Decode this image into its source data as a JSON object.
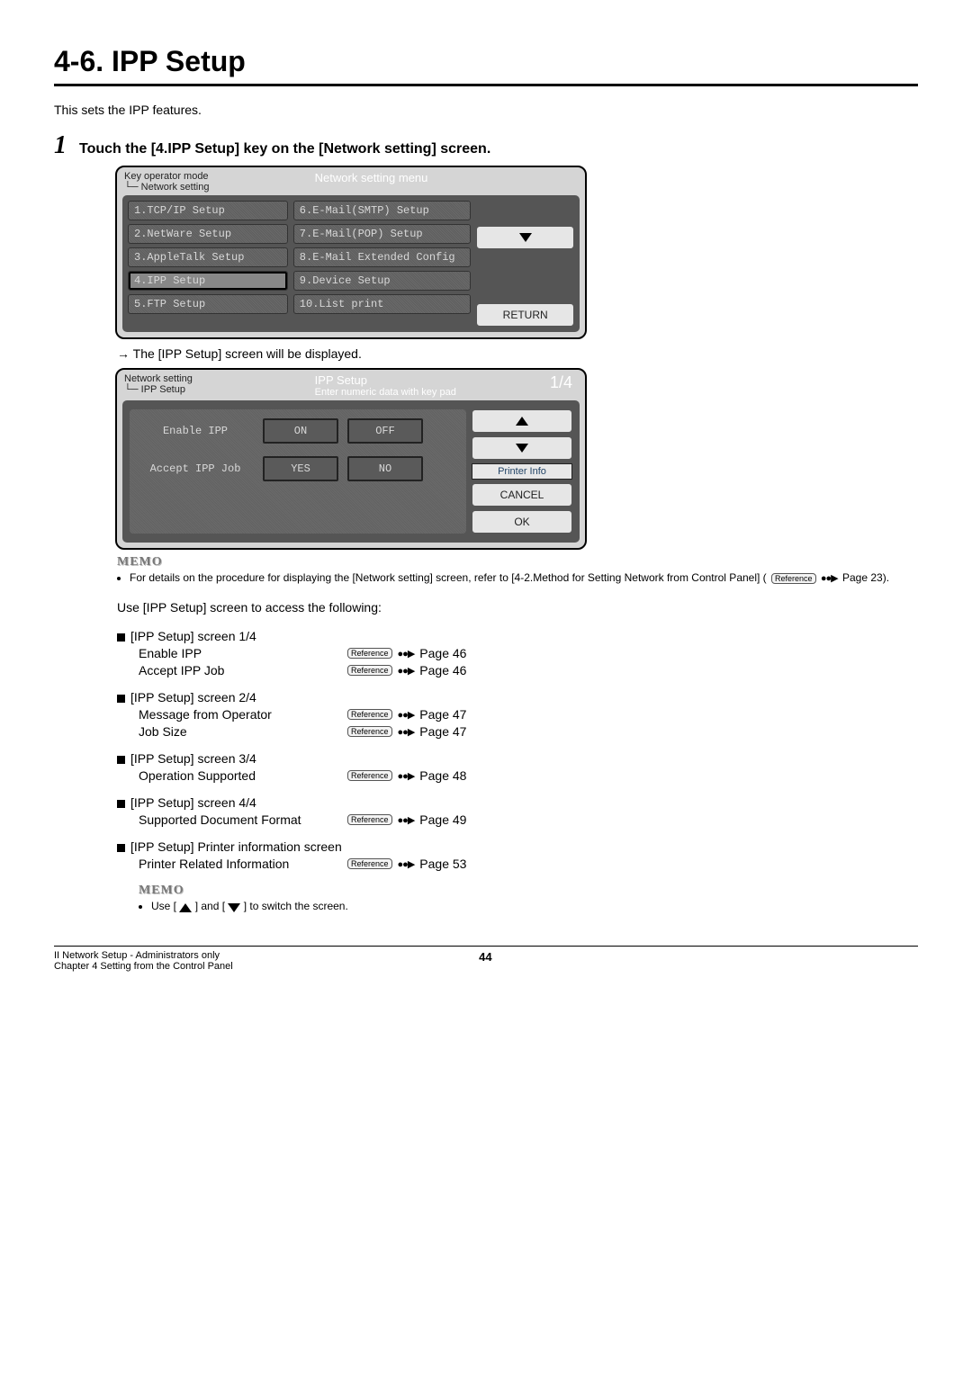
{
  "title": "4-6. IPP Setup",
  "intro": "This sets the IPP features.",
  "step": {
    "num": "1",
    "text": "Touch the [4.IPP Setup] key on the [Network setting] screen."
  },
  "screen1": {
    "hdr_left_line1": "Key operator mode",
    "hdr_left_line2": "└─ Network setting",
    "hdr_center": "Network setting menu",
    "items_left": [
      "1.TCP/IP Setup",
      "2.NetWare Setup",
      "3.AppleTalk Setup",
      "4.IPP Setup",
      "5.FTP Setup"
    ],
    "items_right": [
      "6.E-Mail(SMTP) Setup",
      "7.E-Mail(POP) Setup",
      "8.E-Mail Extended Config",
      "9.Device Setup",
      "10.List print"
    ],
    "return": "RETURN"
  },
  "result_arrow": "→",
  "result_text": "The [IPP Setup] screen will be displayed.",
  "screen2": {
    "hdr_left_line1": "Network setting",
    "hdr_left_line2": "└─ IPP Setup",
    "hdr_center": "IPP Setup",
    "hdr_sub": "Enter numeric data with key pad",
    "page": "1/4",
    "row1_label": "Enable IPP",
    "row1_a": "ON",
    "row1_b": "OFF",
    "row2_label": "Accept IPP Job",
    "row2_a": "YES",
    "row2_b": "NO",
    "printer_info": "Printer Info",
    "cancel": "CANCEL",
    "ok": "OK"
  },
  "memo1_head": "MEMO",
  "memo1_bullet": "For details on the procedure for displaying the [Network setting] screen, refer to [4-2.Method for Setting Network from Control Panel] (",
  "memo1_ref": "Reference",
  "memo1_tail": " Page 23).",
  "use_line": "Use [IPP Setup] screen to access the following:",
  "reference_label": "Reference",
  "items": [
    {
      "head": "[IPP Setup] screen 1/4",
      "subs": [
        {
          "label": "Enable IPP",
          "page": "Page 46"
        },
        {
          "label": "Accept IPP Job",
          "page": "Page 46"
        }
      ]
    },
    {
      "head": "[IPP Setup] screen 2/4",
      "subs": [
        {
          "label": "Message from Operator",
          "page": "Page 47"
        },
        {
          "label": "Job Size",
          "page": "Page 47"
        }
      ]
    },
    {
      "head": "[IPP Setup] screen 3/4",
      "subs": [
        {
          "label": "Operation Supported",
          "page": "Page 48"
        }
      ]
    },
    {
      "head": "[IPP Setup] screen 4/4",
      "subs": [
        {
          "label": "Supported Document Format",
          "page": "Page 49"
        }
      ]
    },
    {
      "head": "[IPP Setup] Printer information screen",
      "subs": [
        {
          "label": "Printer Related Information",
          "page": "Page 53"
        }
      ]
    }
  ],
  "memo2_head": "MEMO",
  "memo2_a": "Use [",
  "memo2_b": "] and [",
  "memo2_c": "] to switch the screen.",
  "footer": {
    "left1": "II Network Setup - Administrators only",
    "left2": "Chapter 4 Setting from the Control Panel",
    "center": "44"
  }
}
